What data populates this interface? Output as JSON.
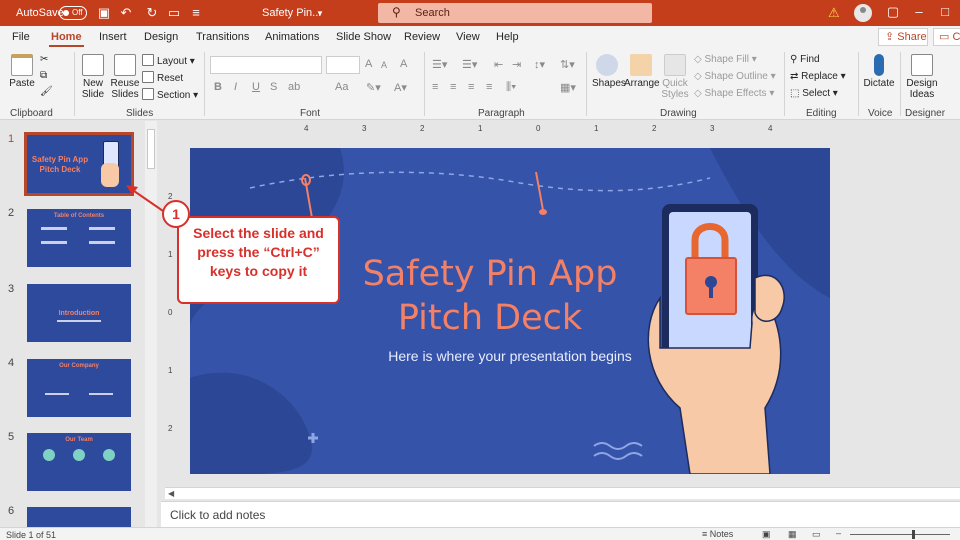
{
  "titlebar": {
    "autosave_label": "AutoSave",
    "autosave_state": "Off",
    "doc_title": "Safety Pin...",
    "search_placeholder": "Search",
    "share_label": "Share",
    "comments_label": "C"
  },
  "tabs": [
    "File",
    "Home",
    "Insert",
    "Design",
    "Transitions",
    "Animations",
    "Slide Show",
    "Review",
    "View",
    "Help"
  ],
  "active_tab": "Home",
  "ribbon": {
    "clipboard": {
      "paste": "Paste",
      "label": "Clipboard"
    },
    "slides": {
      "new_slide": "New Slide",
      "reuse_slides": "Reuse Slides",
      "layout": "Layout",
      "reset": "Reset",
      "section": "Section",
      "label": "Slides"
    },
    "font": {
      "label": "Font",
      "bold": "B",
      "italic": "I",
      "underline": "U",
      "strike": "S",
      "shadow": "ab",
      "grow": "A",
      "shrink": "A",
      "case": "Aa",
      "clear": "A"
    },
    "paragraph": {
      "label": "Paragraph"
    },
    "drawing": {
      "shapes": "Shapes",
      "arrange": "Arrange",
      "quick_styles": "Quick Styles",
      "shape_fill": "Shape Fill",
      "shape_outline": "Shape Outline",
      "shape_effects": "Shape Effects",
      "label": "Drawing"
    },
    "editing": {
      "find": "Find",
      "replace": "Replace",
      "select": "Select",
      "label": "Editing"
    },
    "voice": {
      "dictate": "Dictate",
      "label": "Voice"
    },
    "designer": {
      "design_ideas": "Design Ideas",
      "label": "Designer"
    }
  },
  "thumbnails": [
    {
      "num": "1",
      "title": "Safety Pin App Pitch Deck",
      "selected": true
    },
    {
      "num": "2",
      "title": "Table of Contents",
      "selected": false
    },
    {
      "num": "3",
      "title": "Introduction",
      "selected": false
    },
    {
      "num": "4",
      "title": "Our Company",
      "selected": false
    },
    {
      "num": "5",
      "title": "Our Team",
      "selected": false
    },
    {
      "num": "6",
      "title": "",
      "selected": false
    }
  ],
  "slide": {
    "title_line1": "Safety Pin App",
    "title_line2": "Pitch Deck",
    "subtitle": "Here is where your presentation begins"
  },
  "ruler_h": [
    "4",
    "3",
    "2",
    "1",
    "0",
    "1",
    "2",
    "3",
    "4"
  ],
  "ruler_v": [
    "2",
    "1",
    "0",
    "1",
    "2"
  ],
  "callout": {
    "number": "1",
    "line1": "Select the slide and",
    "line2": "press the “Ctrl+C”",
    "line3": "keys to copy it"
  },
  "notes_placeholder": "Click to add notes",
  "status": {
    "slide_count": "Slide 1 of 51",
    "notes_button": "Notes"
  },
  "colors": {
    "accent": "#c43e1c",
    "slide_bg": "#3553a8",
    "title_salmon": "#f48066",
    "callout_red": "#d8302a"
  }
}
